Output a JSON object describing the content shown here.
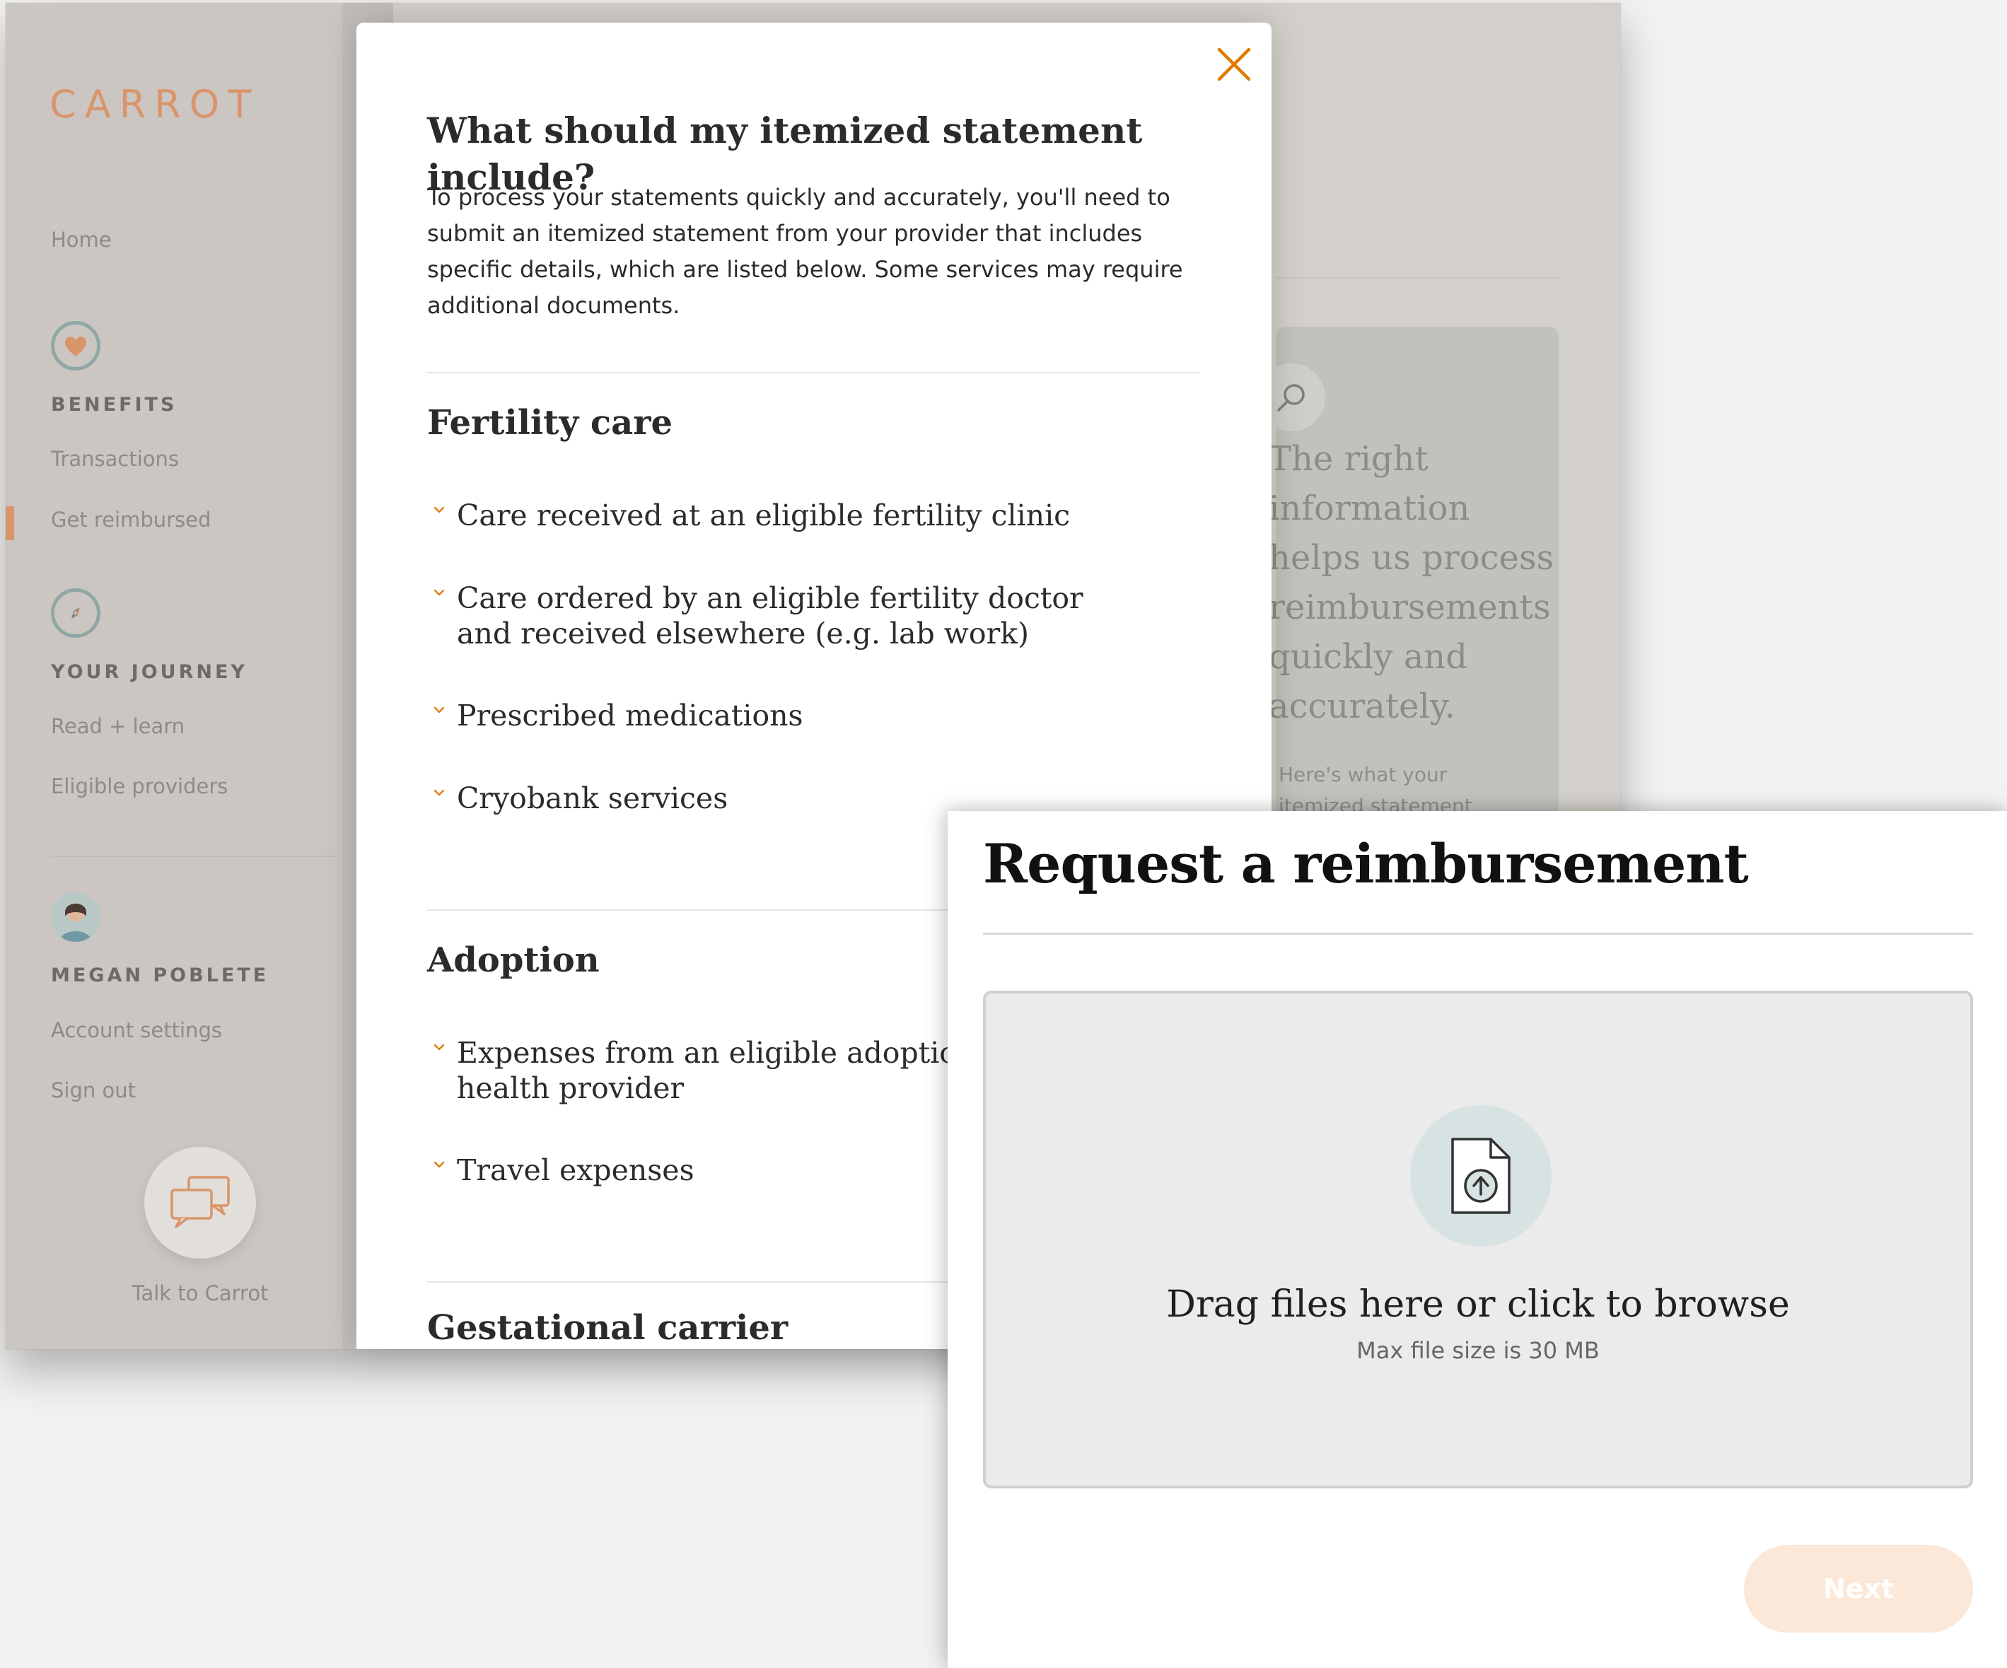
{
  "app": {
    "logo": "CARROT",
    "nav": {
      "home": "Home",
      "benefits_heading": "BENEFITS",
      "transactions": "Transactions",
      "get_reimbursed": "Get reimbursed",
      "journey_heading": "YOUR JOURNEY",
      "read_learn": "Read + learn",
      "eligible_providers": "Eligible providers",
      "user_heading": "MEGAN POBLETE",
      "account_settings": "Account settings",
      "sign_out": "Sign out"
    },
    "chat_label": "Talk to Carrot",
    "info_card": {
      "text": "The right\ninformation\nhelps us process\nreimbursements\nquickly and\naccurately.",
      "subtext": "Here's what your\nitemized statement"
    }
  },
  "modal": {
    "title": "What should my itemized statement include?",
    "intro": "To process your statements quickly and accurately, you'll need to submit an itemized statement from your provider that includes specific details, which are listed below. Some services may require additional documents.",
    "sections": [
      {
        "title": "Fertility care",
        "items": [
          "Care received at an eligible fertility clinic",
          "Care ordered by an eligible fertility doctor and received elsewhere (e.g. lab work)",
          "Prescribed medications",
          "Cryobank services"
        ]
      },
      {
        "title": "Adoption",
        "items": [
          "Expenses from an eligible adoption agency or health provider",
          "Travel expenses"
        ]
      },
      {
        "title": "Gestational carrier",
        "items": []
      }
    ]
  },
  "reimbursement": {
    "title": "Request a reimbursement",
    "dropzone_title": "Drag files here or click to browse",
    "dropzone_sub": "Max file size is 30 MB",
    "next_label": "Next"
  },
  "colors": {
    "brand": "#d9956a",
    "accent_icon": "#e07b00",
    "sidebar_bg": "#cbc6c1",
    "next_button": "#fbe8d8"
  },
  "icons": {
    "close": "close-icon",
    "chevron": "chevron-down-icon",
    "heart": "heart-icon",
    "compass": "compass-icon",
    "avatar": "avatar",
    "chat": "chat-bubbles-icon",
    "search": "search-icon",
    "upload": "file-upload-icon"
  }
}
